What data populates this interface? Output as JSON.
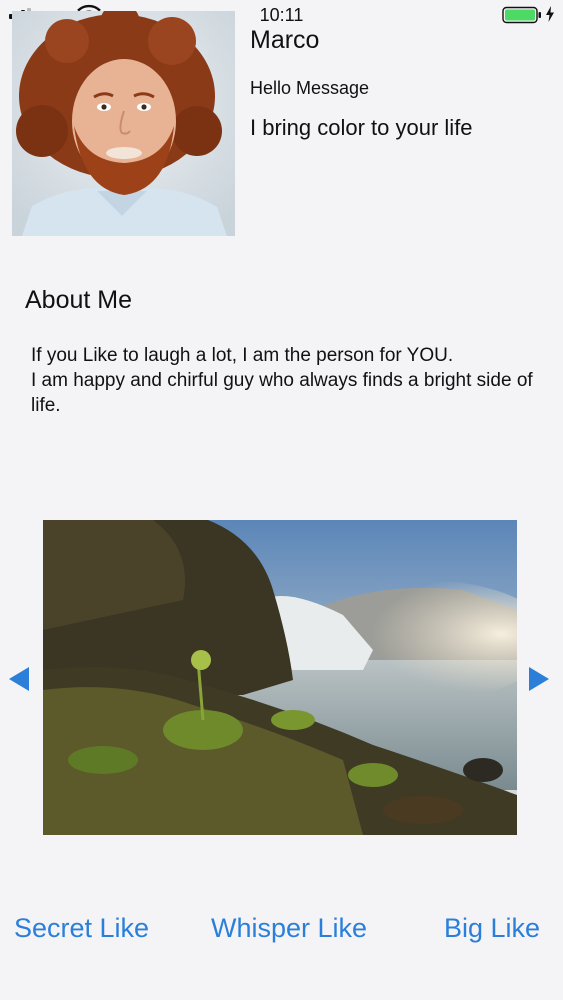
{
  "status_bar": {
    "time": "10:11",
    "signal_icon": "cellular-signal-icon",
    "wifi_icon": "wifi-icon",
    "battery_icon": "battery-icon",
    "battery_color": "#4cd964"
  },
  "profile": {
    "name": "Marco",
    "hello_label": "Hello Message",
    "tagline": "I bring color to your life"
  },
  "about": {
    "title": "About Me",
    "text": "If you Like to laugh a lot, I am the person for YOU.\nI am happy and chirful guy who always finds a  bright side of life."
  },
  "gallery": {
    "prev_icon": "triangle-left-icon",
    "next_icon": "triangle-right-icon",
    "accent": "#2b7fd9"
  },
  "actions": {
    "secret_like": "Secret Like",
    "whisper_like": "Whisper Like",
    "big_like": "Big Like"
  }
}
